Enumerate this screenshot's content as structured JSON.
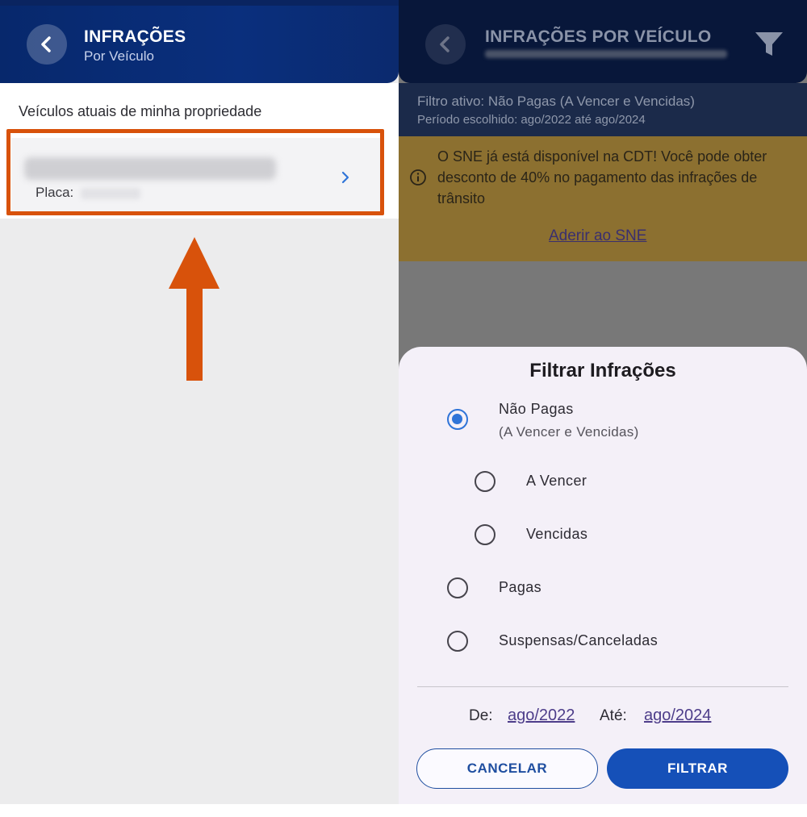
{
  "left_screen": {
    "header": {
      "title": "INFRAÇÕES",
      "subtitle": "Por Veículo"
    },
    "section_label": "Veículos atuais de minha propriedade",
    "vehicle": {
      "placa_label": "Placa:"
    }
  },
  "right_screen": {
    "header": {
      "title": "INFRAÇÕES POR VEÍCULO"
    },
    "active_filter": "Filtro ativo: Não Pagas (A Vencer e Vencidas)",
    "period": "Período escolhido: ago/2022 até ago/2024",
    "notice": {
      "text": "O SNE já está disponível na CDT! Você pode obter desconto de 40% no pagamento das infrações de trânsito",
      "link": "Aderir ao SNE"
    },
    "filter_sheet": {
      "title": "Filtrar Infrações",
      "options": [
        {
          "label": "Não Pagas",
          "sublabel": "(A Vencer e Vencidas)",
          "checked": true
        },
        {
          "label": "A Vencer",
          "checked": false
        },
        {
          "label": "Vencidas",
          "checked": false
        },
        {
          "label": "Pagas",
          "checked": false
        },
        {
          "label": "Suspensas/Canceladas",
          "checked": false
        }
      ],
      "from_label": "De:",
      "from_value": "ago/2022",
      "to_label": "Até:",
      "to_value": "ago/2024",
      "cancel_label": "CANCELAR",
      "filter_label": "FILTRAR"
    }
  },
  "colors": {
    "header_blue": "#0a2f7d",
    "highlight_orange": "#d8520b",
    "radio_checked": "#2f74d8",
    "filter_button": "#1550b8",
    "notice_bg": "#8c7030"
  }
}
